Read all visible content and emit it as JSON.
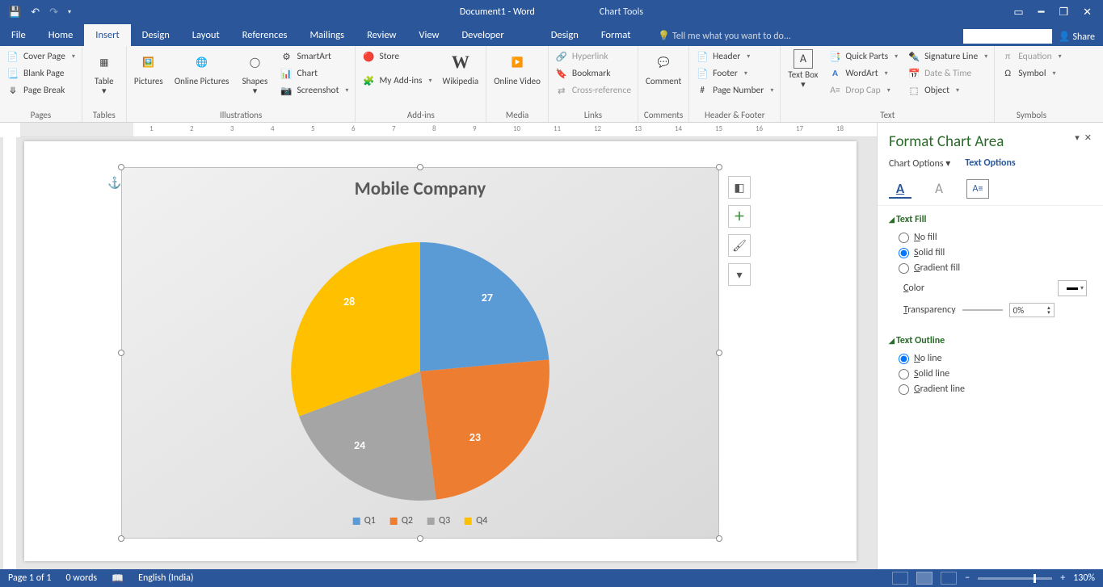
{
  "titlebar": {
    "doc_title": "Document1 - Word",
    "tools_title": "Chart Tools"
  },
  "tabs": {
    "file": "File",
    "home": "Home",
    "insert": "Insert",
    "design": "Design",
    "layout": "Layout",
    "references": "References",
    "mailings": "Mailings",
    "review": "Review",
    "view": "View",
    "developer": "Developer",
    "ct_design": "Design",
    "ct_format": "Format",
    "tell_me": "Tell me what you want to do...",
    "share": "Share"
  },
  "ribbon": {
    "pages": {
      "cover": "Cover Page",
      "blank": "Blank Page",
      "break": "Page Break",
      "cap": "Pages"
    },
    "tables": {
      "table": "Table",
      "cap": "Tables"
    },
    "illus": {
      "pictures": "Pictures",
      "online": "Online Pictures",
      "shapes": "Shapes",
      "smart": "SmartArt",
      "chart": "Chart",
      "screenshot": "Screenshot",
      "cap": "Illustrations"
    },
    "addins": {
      "store": "Store",
      "myaddins": "My Add-ins",
      "wiki": "Wikipedia",
      "cap": "Add-ins"
    },
    "media": {
      "video": "Online Video",
      "cap": "Media"
    },
    "links": {
      "hyper": "Hyperlink",
      "bookmark": "Bookmark",
      "xref": "Cross-reference",
      "cap": "Links"
    },
    "comments": {
      "comment": "Comment",
      "cap": "Comments"
    },
    "hf": {
      "header": "Header",
      "footer": "Footer",
      "pagenum": "Page Number",
      "cap": "Header & Footer"
    },
    "text": {
      "textbox": "Text Box",
      "quick": "Quick Parts",
      "wordart": "WordArt",
      "dropcap": "Drop Cap",
      "sig": "Signature Line",
      "date": "Date & Time",
      "object": "Object",
      "cap": "Text"
    },
    "symbols": {
      "equation": "Equation",
      "symbol": "Symbol",
      "cap": "Symbols"
    }
  },
  "chart_data": {
    "type": "pie",
    "title": "Mobile Company",
    "categories": [
      "Q1",
      "Q2",
      "Q3",
      "Q4"
    ],
    "values": [
      27,
      23,
      24,
      28
    ],
    "colors": [
      "#5b9bd5",
      "#ed7d31",
      "#a5a5a5",
      "#ffc000"
    ],
    "legend_position": "bottom"
  },
  "side_buttons": {
    "layout": "layout",
    "plus": "+",
    "brush": "brush",
    "filter": "filter"
  },
  "panel": {
    "title": "Format Chart Area",
    "chart_options": "Chart Options",
    "text_options": "Text Options",
    "text_fill": "Text Fill",
    "no_fill": "No fill",
    "solid_fill": "Solid fill",
    "gradient_fill": "Gradient fill",
    "color": "Color",
    "transparency": "Transparency",
    "trans_val": "0%",
    "text_outline": "Text Outline",
    "no_line": "No line",
    "solid_line": "Solid line",
    "gradient_line": "Gradient line"
  },
  "status": {
    "page": "Page 1 of 1",
    "words": "0 words",
    "lang": "English (India)",
    "zoom": "130%"
  }
}
